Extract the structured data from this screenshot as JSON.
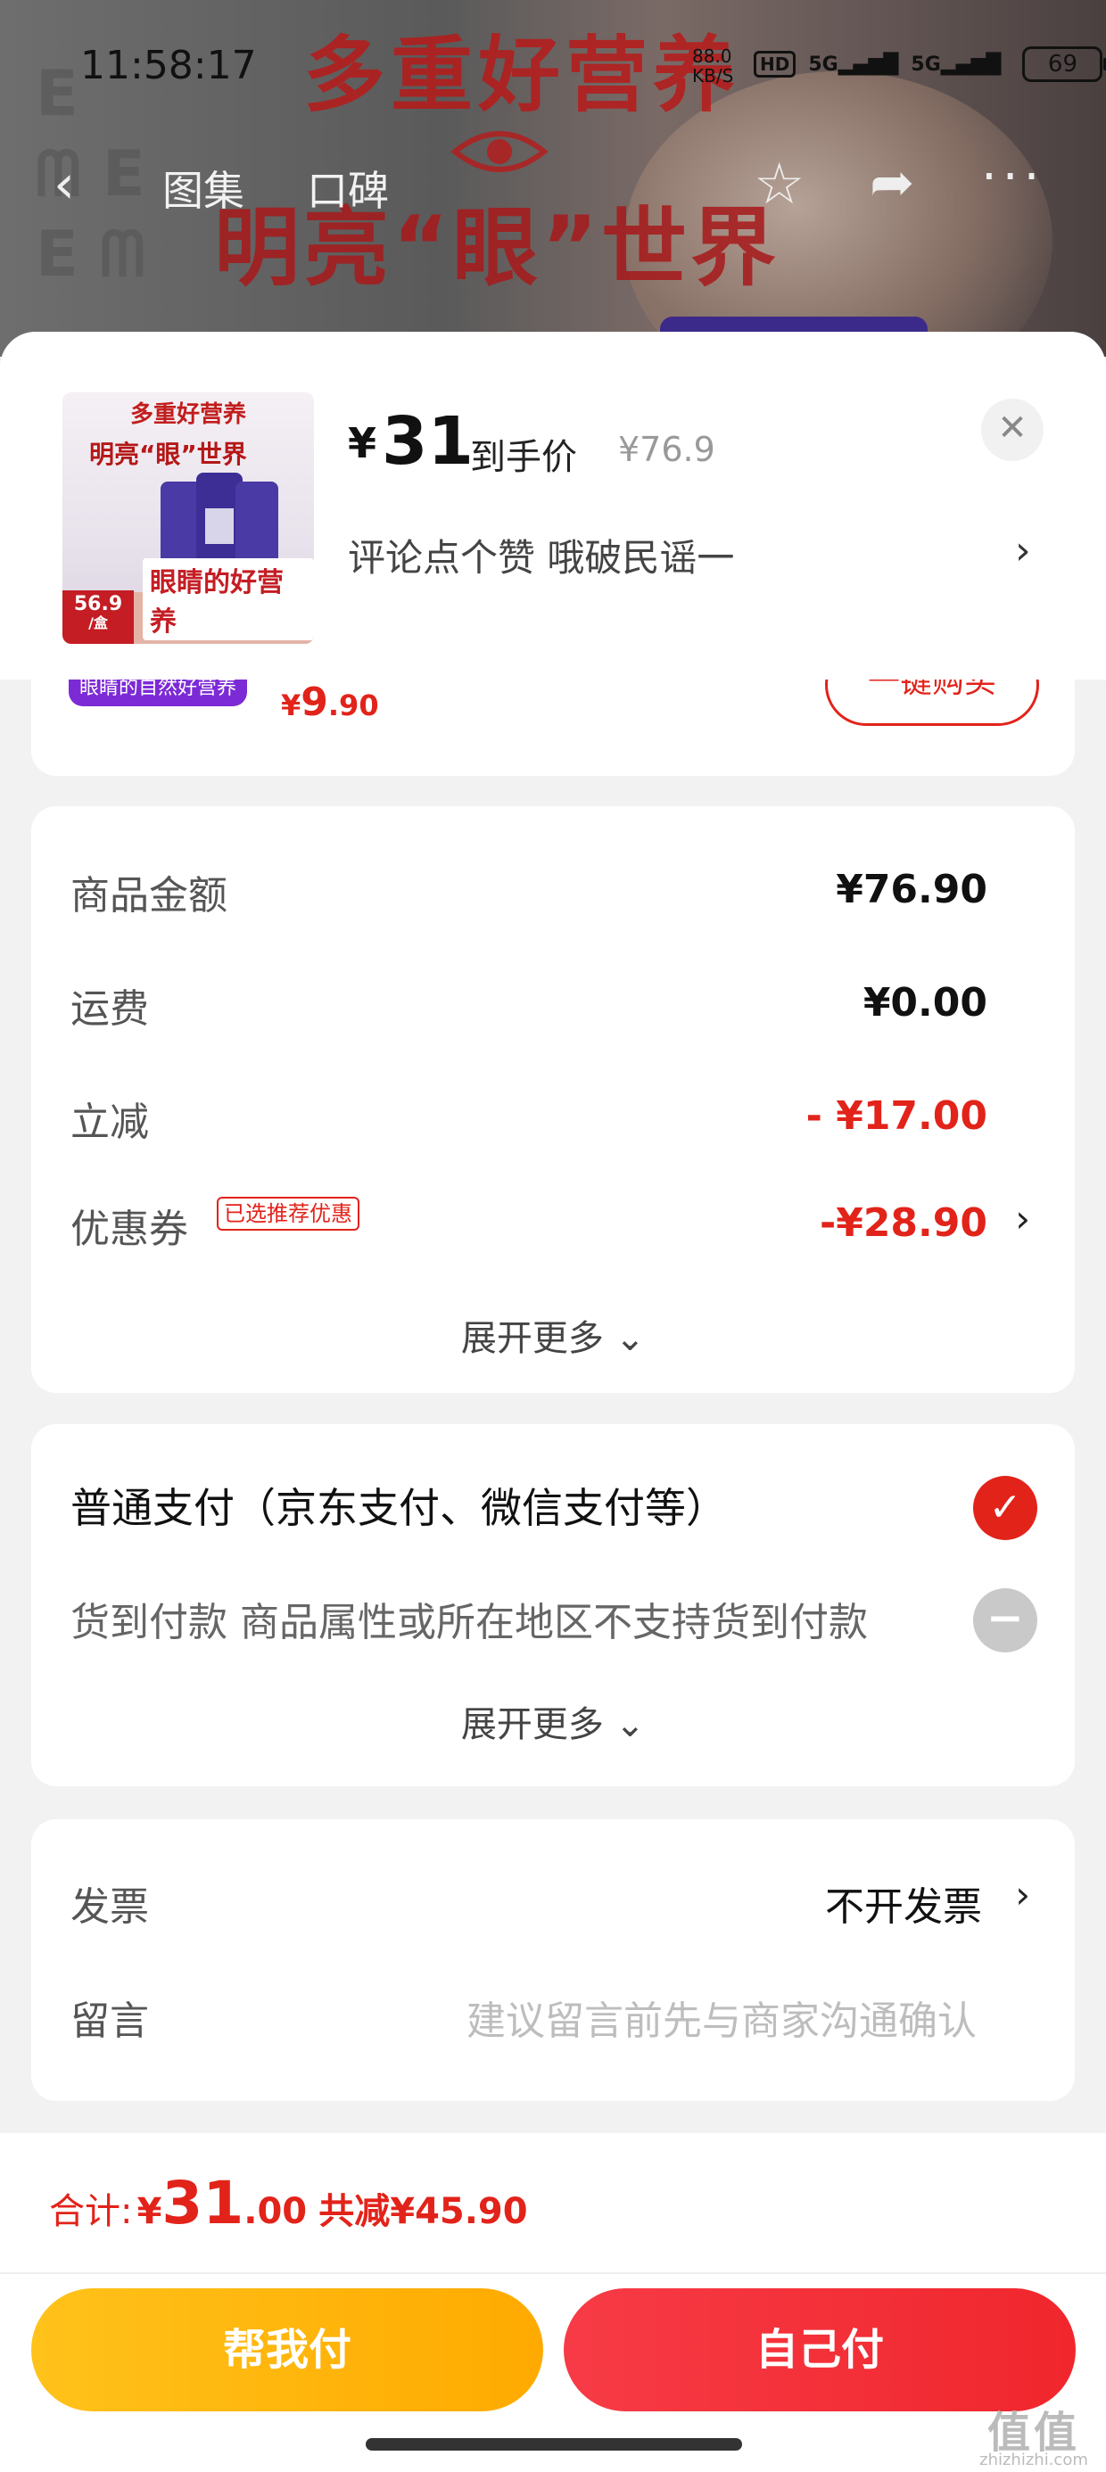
{
  "status_bar": {
    "time": "11:58:17",
    "net_speed": "88.0",
    "net_unit": "KB/S",
    "hd": "HD",
    "signal1": "5G",
    "signal2": "5G",
    "battery": "69"
  },
  "background_banner": {
    "line1": "多重好营养",
    "line2": "明亮“眼”世界"
  },
  "nav": {
    "tab_gallery": "图集",
    "tab_reviews": "口碑"
  },
  "product": {
    "thumb_title": "多重好营养",
    "thumb_subtitle": "明亮“眼”世界",
    "thumb_badge_price": "56.9",
    "thumb_badge_unit": "/盒",
    "thumb_footer": "眼睛的好营养",
    "price_currency": "¥",
    "price_value": "31",
    "price_label": "到手价",
    "price_original": "¥76.9",
    "promo_text": "评论点个赞  哦破民谣一"
  },
  "peek_item": {
    "tag": "眼睛的自然好营养",
    "price_prefix": "¥",
    "price_int": "9",
    "price_dec": ".90",
    "button": "一键购买"
  },
  "summary": {
    "rows": [
      {
        "label": "商品金额",
        "value": "¥76.90"
      },
      {
        "label": "运费",
        "value": "¥0.00"
      },
      {
        "label": "立减",
        "value": "- ¥17.00"
      },
      {
        "label": "优惠券",
        "value": "-¥28.90",
        "tag": "已选推荐优惠"
      }
    ],
    "expand": "展开更多"
  },
  "payment": {
    "option1": "普通支付（京东支付、微信支付等）",
    "option2": "货到付款 商品属性或所在地区不支持货到付款",
    "expand": "展开更多"
  },
  "extra": {
    "invoice_label": "发票",
    "invoice_value": "不开发票",
    "note_label": "留言",
    "note_placeholder": "建议留言前先与商家沟通确认"
  },
  "footer": {
    "total_label": "合计:",
    "total_yen": "¥",
    "total_int": "31",
    "total_dec": ".00",
    "saved": "共减¥45.90",
    "btn_help": "帮我付",
    "btn_self": "自己付"
  },
  "watermark": {
    "mark": "值值值",
    "url": "zhizhizhi.com"
  },
  "colors": {
    "accent_red": "#e2231a",
    "button_yellow": "#ffb400",
    "button_red": "#f0262c"
  },
  "icons": [
    "back-icon",
    "star-icon",
    "share-icon",
    "more-icon",
    "close-icon",
    "chevron-right-icon",
    "chevron-down-icon",
    "check-icon",
    "minus-icon",
    "eye-icon"
  ]
}
